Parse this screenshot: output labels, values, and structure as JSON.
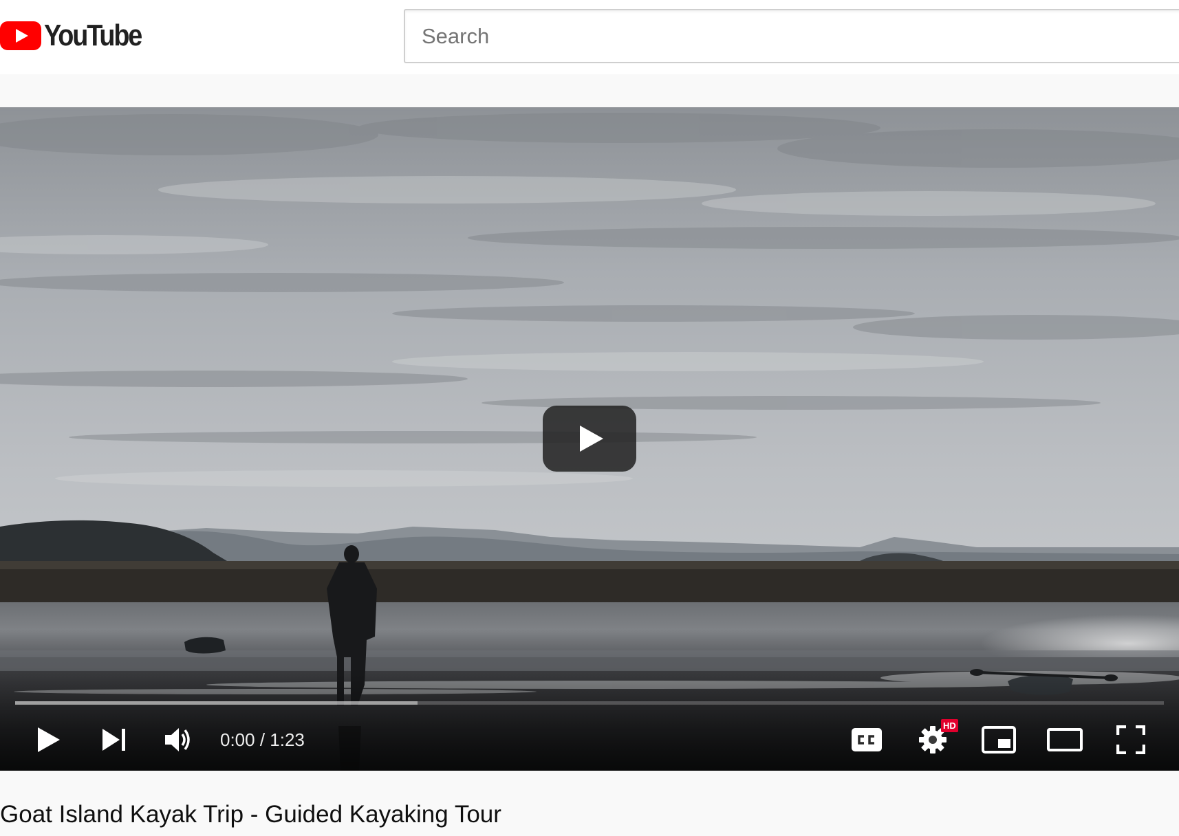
{
  "masthead": {
    "logo_text": "YouTube",
    "search": {
      "placeholder": "Search",
      "value": ""
    }
  },
  "player": {
    "state": "paused",
    "current_time": "0:00",
    "time_separator": " / ",
    "duration": "1:23",
    "time_text": "0:00 / 1:23",
    "played_fraction": 0.0,
    "buffered_fraction": 0.35,
    "quality_badge": "HD",
    "icons": {
      "big_play": "large-play-icon",
      "play": "play-icon",
      "next": "skip-next-icon",
      "volume": "volume-icon",
      "captions": "closed-captions-icon",
      "settings": "gear-icon",
      "miniplayer": "miniplayer-icon",
      "theater": "theater-mode-icon",
      "fullscreen": "fullscreen-icon"
    }
  },
  "video": {
    "title": "Goat Island Kayak Trip - Guided Kayaking Tour"
  },
  "colors": {
    "brand_red": "#ff0000",
    "logo_red": "#ff0000",
    "hd_badge": "#e1002d",
    "title_text": "#0f0f0f",
    "page_background": "#f9f9f9"
  }
}
